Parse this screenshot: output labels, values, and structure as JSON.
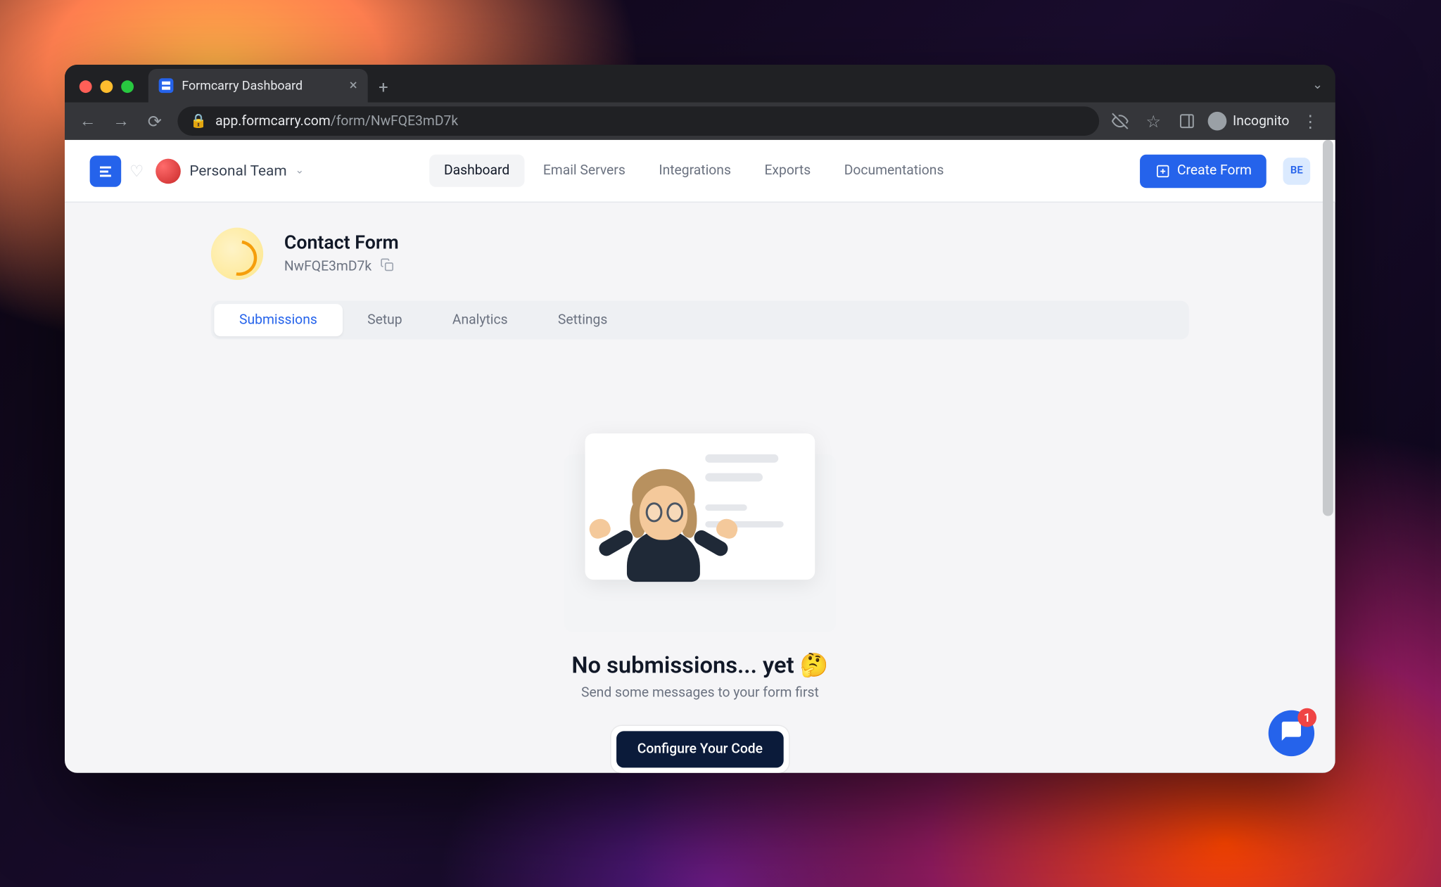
{
  "browser": {
    "tab_title": "Formcarry Dashboard",
    "url_domain": "app.formcarry.com",
    "url_path": "/form/NwFQE3mD7k",
    "incognito_label": "Incognito"
  },
  "header": {
    "team_name": "Personal Team",
    "nav": {
      "dashboard": "Dashboard",
      "email_servers": "Email Servers",
      "integrations": "Integrations",
      "exports": "Exports",
      "documentations": "Documentations"
    },
    "create_form": "Create Form",
    "user_initials": "BE"
  },
  "form": {
    "title": "Contact Form",
    "id": "NwFQE3mD7k"
  },
  "tabs": {
    "submissions": "Submissions",
    "setup": "Setup",
    "analytics": "Analytics",
    "settings": "Settings"
  },
  "empty_state": {
    "title": "No submissions... yet 🤔",
    "subtitle": "Send some messages to your form first",
    "button": "Configure Your Code"
  },
  "chat": {
    "badge_count": "1"
  }
}
